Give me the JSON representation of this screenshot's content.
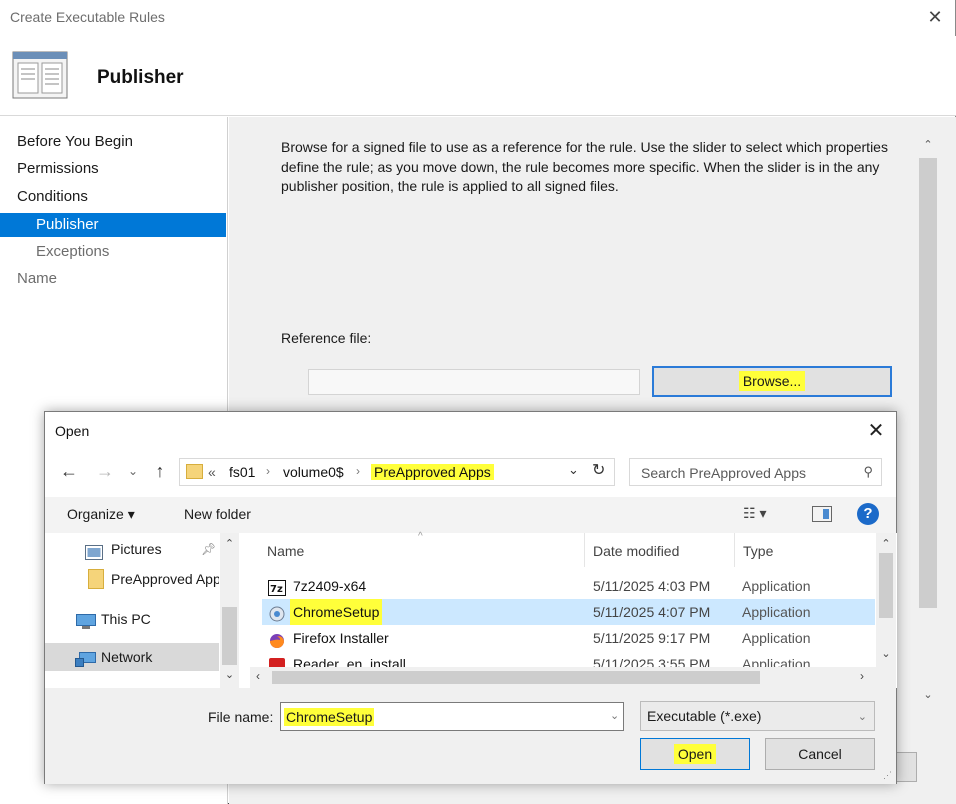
{
  "wizard": {
    "window_title": "Create Executable Rules",
    "heading": "Publisher",
    "nav": [
      {
        "label": "Before You Begin",
        "level": 0,
        "state": "normal"
      },
      {
        "label": "Permissions",
        "level": 0,
        "state": "normal"
      },
      {
        "label": "Conditions",
        "level": 0,
        "state": "normal"
      },
      {
        "label": "Publisher",
        "level": 1,
        "state": "active"
      },
      {
        "label": "Exceptions",
        "level": 1,
        "state": "dim"
      },
      {
        "label": "Name",
        "level": 0,
        "state": "dim"
      }
    ],
    "description": "Browse for a signed file to use as a reference for the rule. Use the slider to select which properties define the rule; as you move down, the rule becomes more specific. When the slider is in the any publisher position, the rule is applied to all signed files.",
    "reference_label": "Reference file:",
    "reference_value": "",
    "browse_label": "Browse..."
  },
  "dialog": {
    "title": "Open",
    "address": {
      "chevron": "«",
      "crumbs": [
        "fs01",
        "volume0$",
        "PreApproved Apps"
      ]
    },
    "search_placeholder": "Search PreApproved Apps",
    "toolbar": {
      "organize": "Organize ▾",
      "new_folder": "New folder"
    },
    "tree": [
      {
        "label": "Pictures",
        "icon": "pictures-icon",
        "pinned": true
      },
      {
        "label": "PreApproved Apps",
        "icon": "folder-icon",
        "pinned": false
      },
      {
        "label": "This PC",
        "icon": "computer-icon",
        "pinned": false
      },
      {
        "label": "Network",
        "icon": "network-icon",
        "pinned": false,
        "selected": true
      }
    ],
    "columns": {
      "name": "Name",
      "date": "Date modified",
      "type": "Type"
    },
    "files": [
      {
        "name": "7z2409-x64",
        "date": "5/11/2025 4:03 PM",
        "type": "Application",
        "icon": "7zip-icon",
        "selected": false
      },
      {
        "name": "ChromeSetup",
        "date": "5/11/2025 4:07 PM",
        "type": "Application",
        "icon": "chrome-setup-icon",
        "selected": true
      },
      {
        "name": "Firefox Installer",
        "date": "5/11/2025 9:17 PM",
        "type": "Application",
        "icon": "firefox-icon",
        "selected": false
      },
      {
        "name": "Reader_en_install",
        "date": "5/11/2025 3:55 PM",
        "type": "Application",
        "icon": "acrobat-icon",
        "selected": false
      }
    ],
    "file_name_label": "File name:",
    "file_name_value": "ChromeSetup",
    "file_type_value": "Executable (*.exe)",
    "open_label": "Open",
    "cancel_label": "Cancel"
  },
  "colors": {
    "accent": "#0078d7",
    "highlight": "#ffff3a",
    "selection": "#cce8ff"
  }
}
